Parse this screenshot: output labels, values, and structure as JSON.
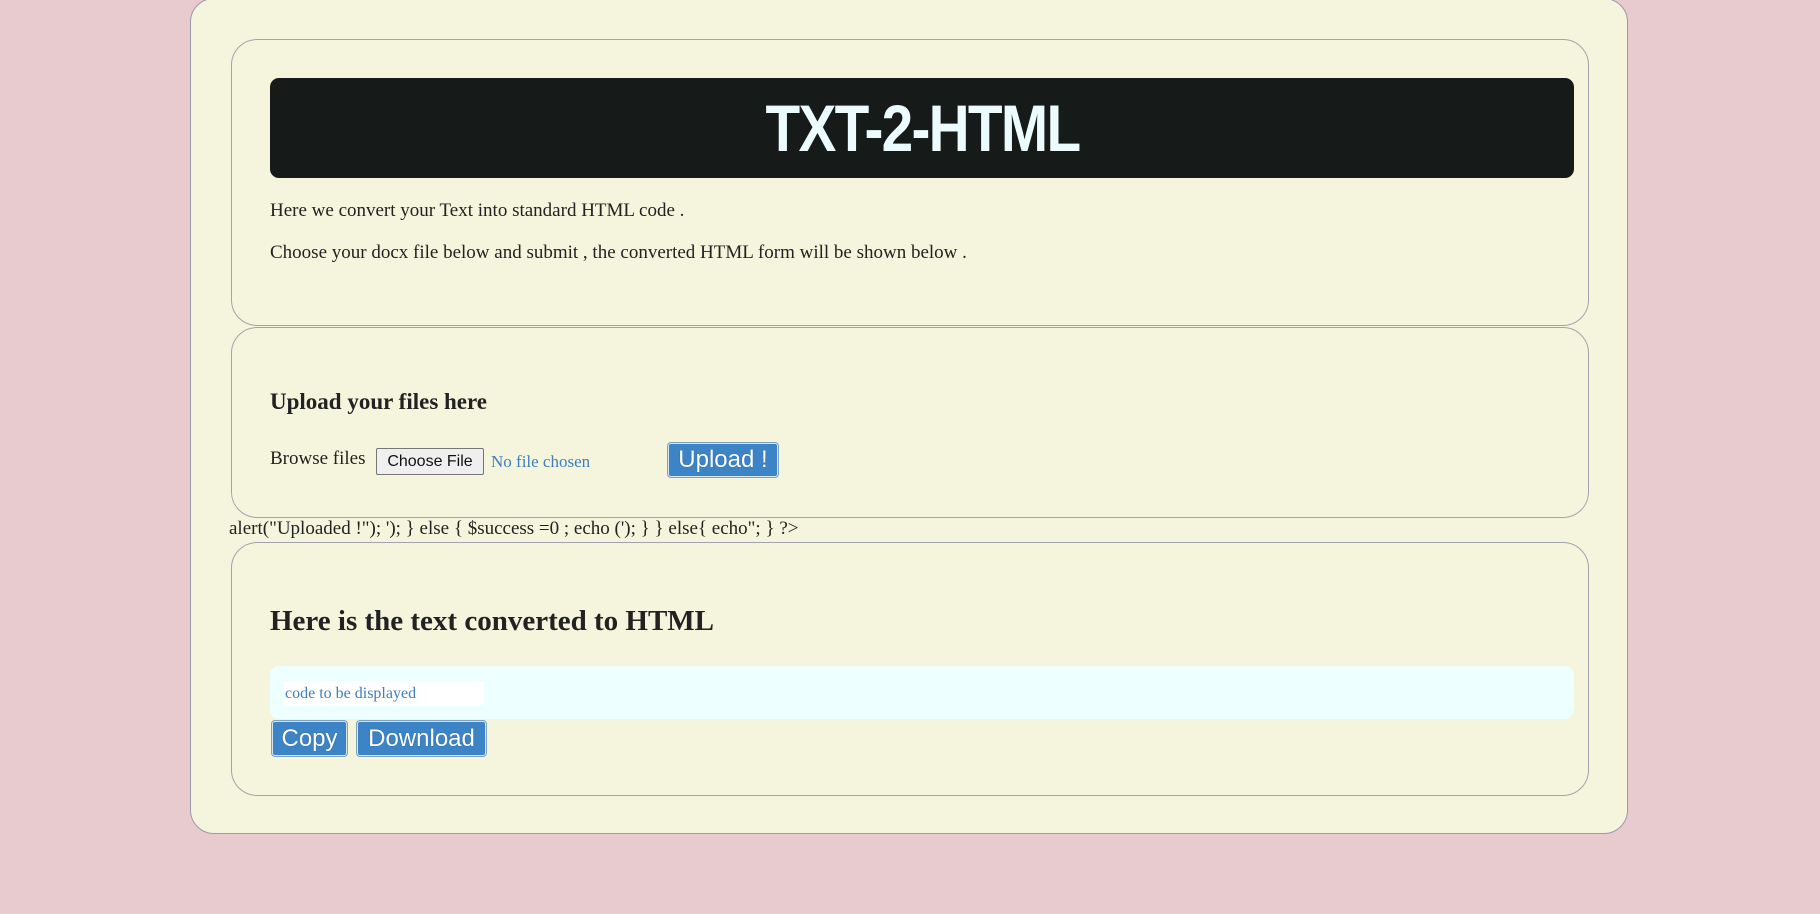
{
  "header": {
    "title": "TXT-2-HTML"
  },
  "intro": {
    "line1": "Here we convert your Text into standard HTML code .",
    "line2": "Choose your docx file below and submit , the converted HTML form will be shown below ."
  },
  "upload": {
    "heading": "Upload your files here",
    "browse_label": "Browse files",
    "choose_file_label": "Choose File",
    "file_status": "No file chosen",
    "upload_button": "Upload !"
  },
  "stray_code": "alert(\"Uploaded !\"); '); } else { $success =0 ; echo ('); } } else{ echo\"; } ?>",
  "output": {
    "heading": "Here is the text converted to HTML",
    "code_placeholder": "code to be displayed",
    "copy_button": "Copy",
    "download_button": "Download"
  },
  "colors": {
    "page_background": "#e8cbcf",
    "panel_background": "#f5f4dc",
    "title_bar": "#161a19",
    "title_text": "#ecfbfd",
    "button_blue": "#3d84c6",
    "code_area": "#edfffe",
    "link_blue": "#3f7fbd"
  }
}
